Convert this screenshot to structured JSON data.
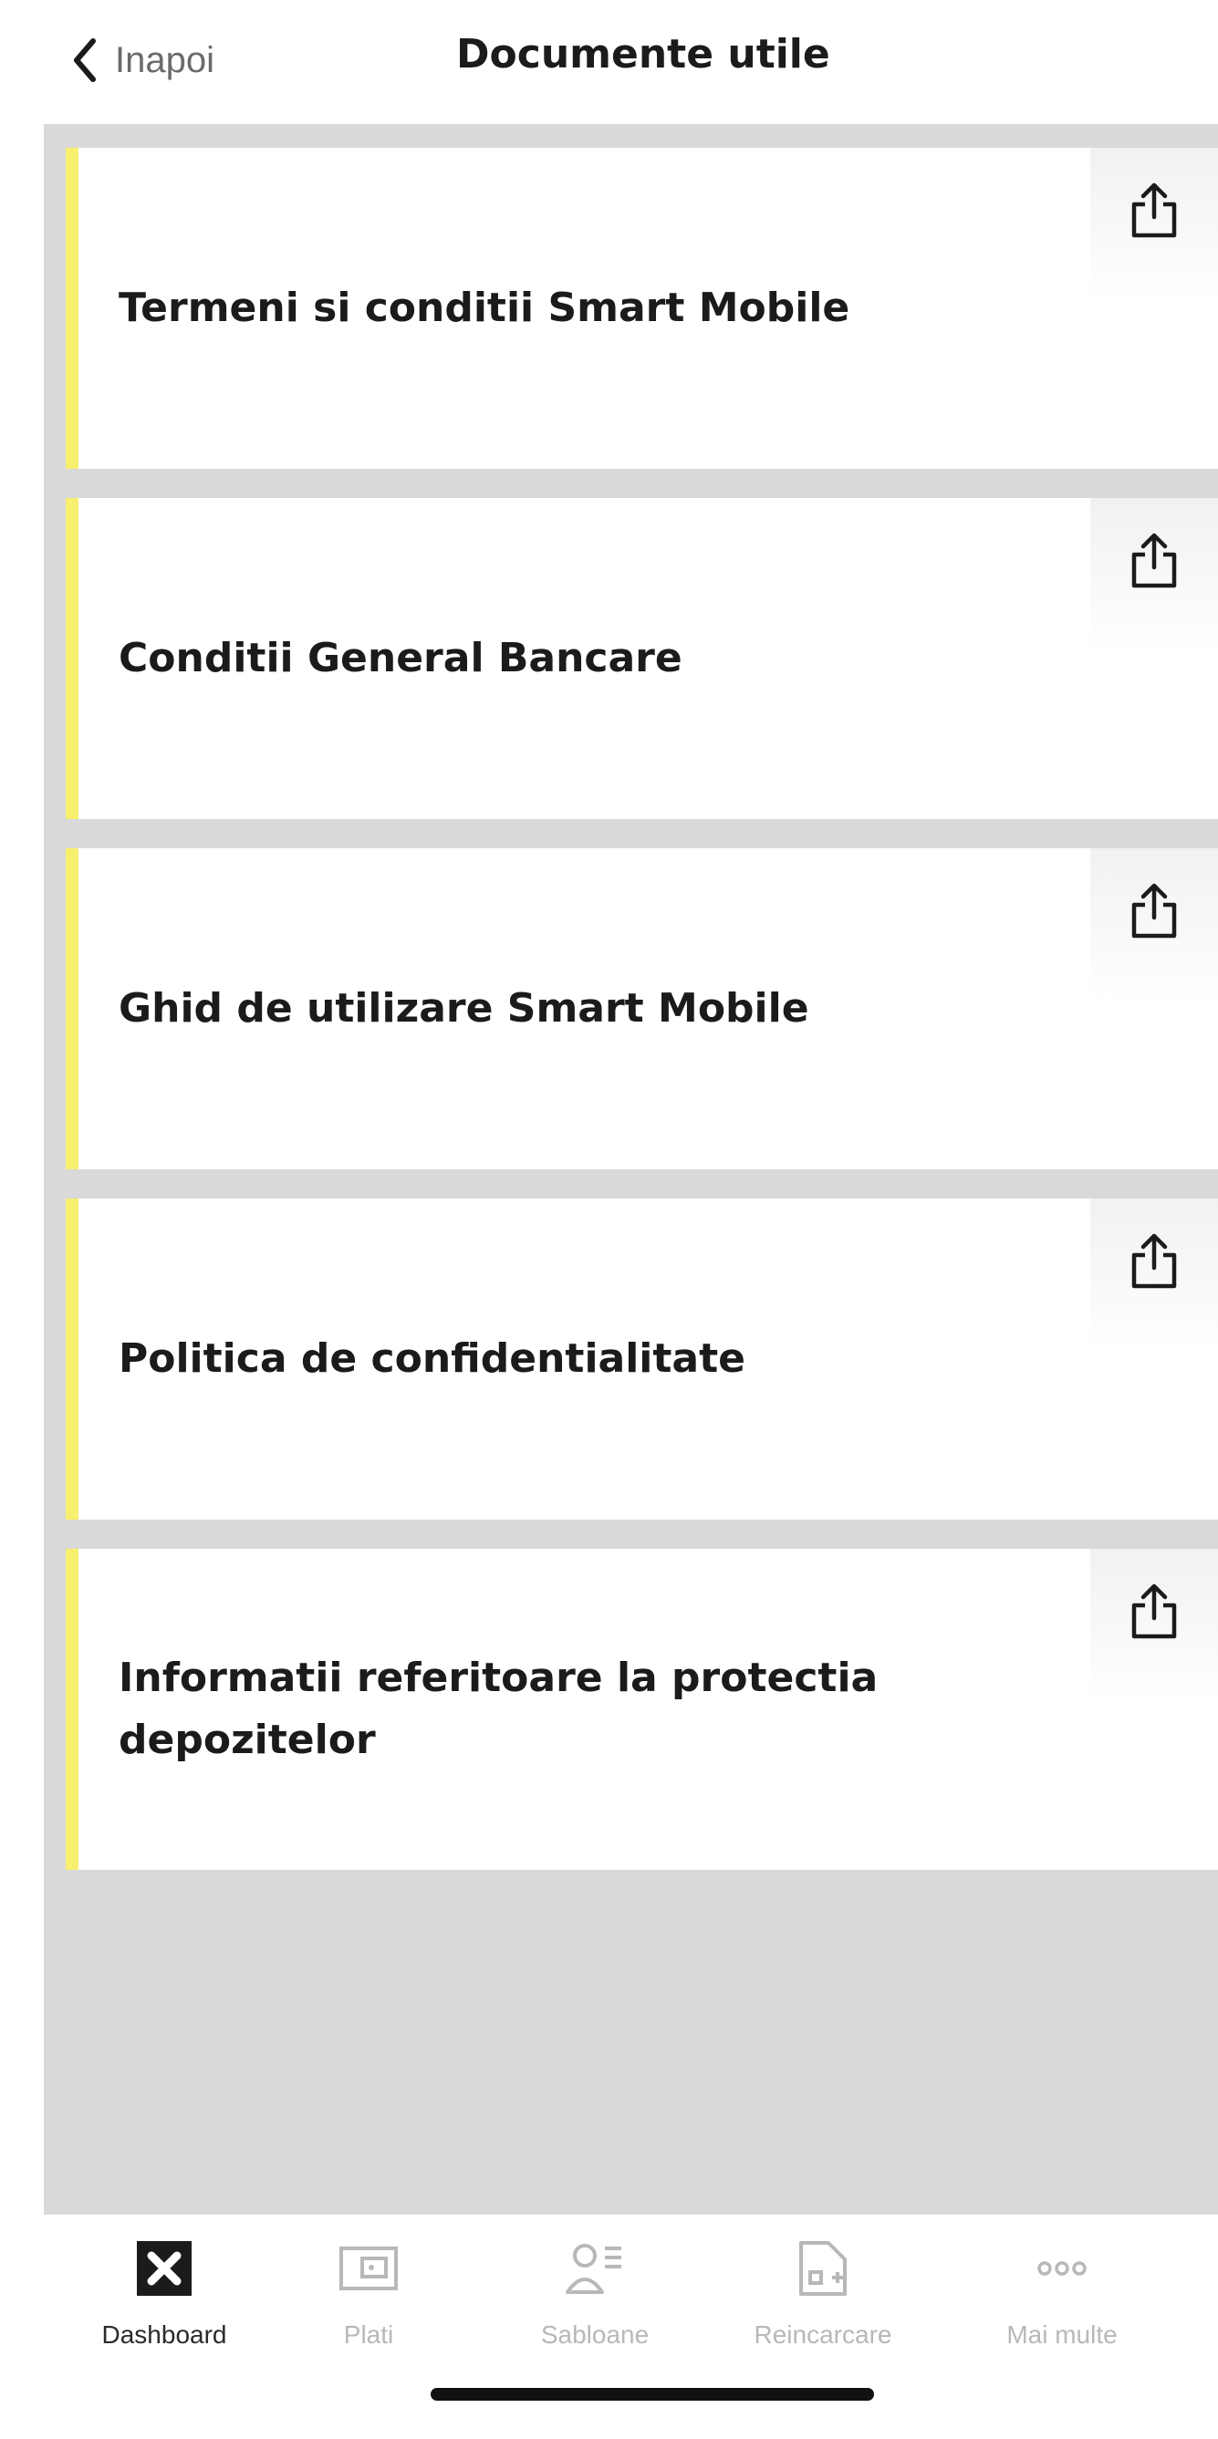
{
  "header": {
    "back_label": "Inapoi",
    "title": "Documente utile"
  },
  "documents": [
    {
      "title": "Termeni si conditii Smart Mobile",
      "action_icon": "share-icon"
    },
    {
      "title": "Conditii General Bancare",
      "action_icon": "share-icon"
    },
    {
      "title": "Ghid de utilizare Smart Mobile",
      "action_icon": "share-icon"
    },
    {
      "title": "Politica de confidentialitate",
      "action_icon": "share-icon"
    },
    {
      "title": "Informatii referitoare la protectia depozitelor",
      "action_icon": "share-icon"
    }
  ],
  "tabbar": {
    "items": [
      {
        "label": "Dashboard",
        "icon": "dashboard-icon",
        "active": true
      },
      {
        "label": "Plati",
        "icon": "wallet-icon",
        "active": false
      },
      {
        "label": "Sabloane",
        "icon": "templates-icon",
        "active": false
      },
      {
        "label": "Reincarcare",
        "icon": "recharge-icon",
        "active": false
      },
      {
        "label": "Mai multe",
        "icon": "more-icon",
        "active": false
      }
    ]
  },
  "colors": {
    "accent": "#f7ef6e",
    "background": "#d9d9d9",
    "card": "#ffffff",
    "text": "#1b1b1b",
    "inactive_tab": "#b8b8b8"
  }
}
